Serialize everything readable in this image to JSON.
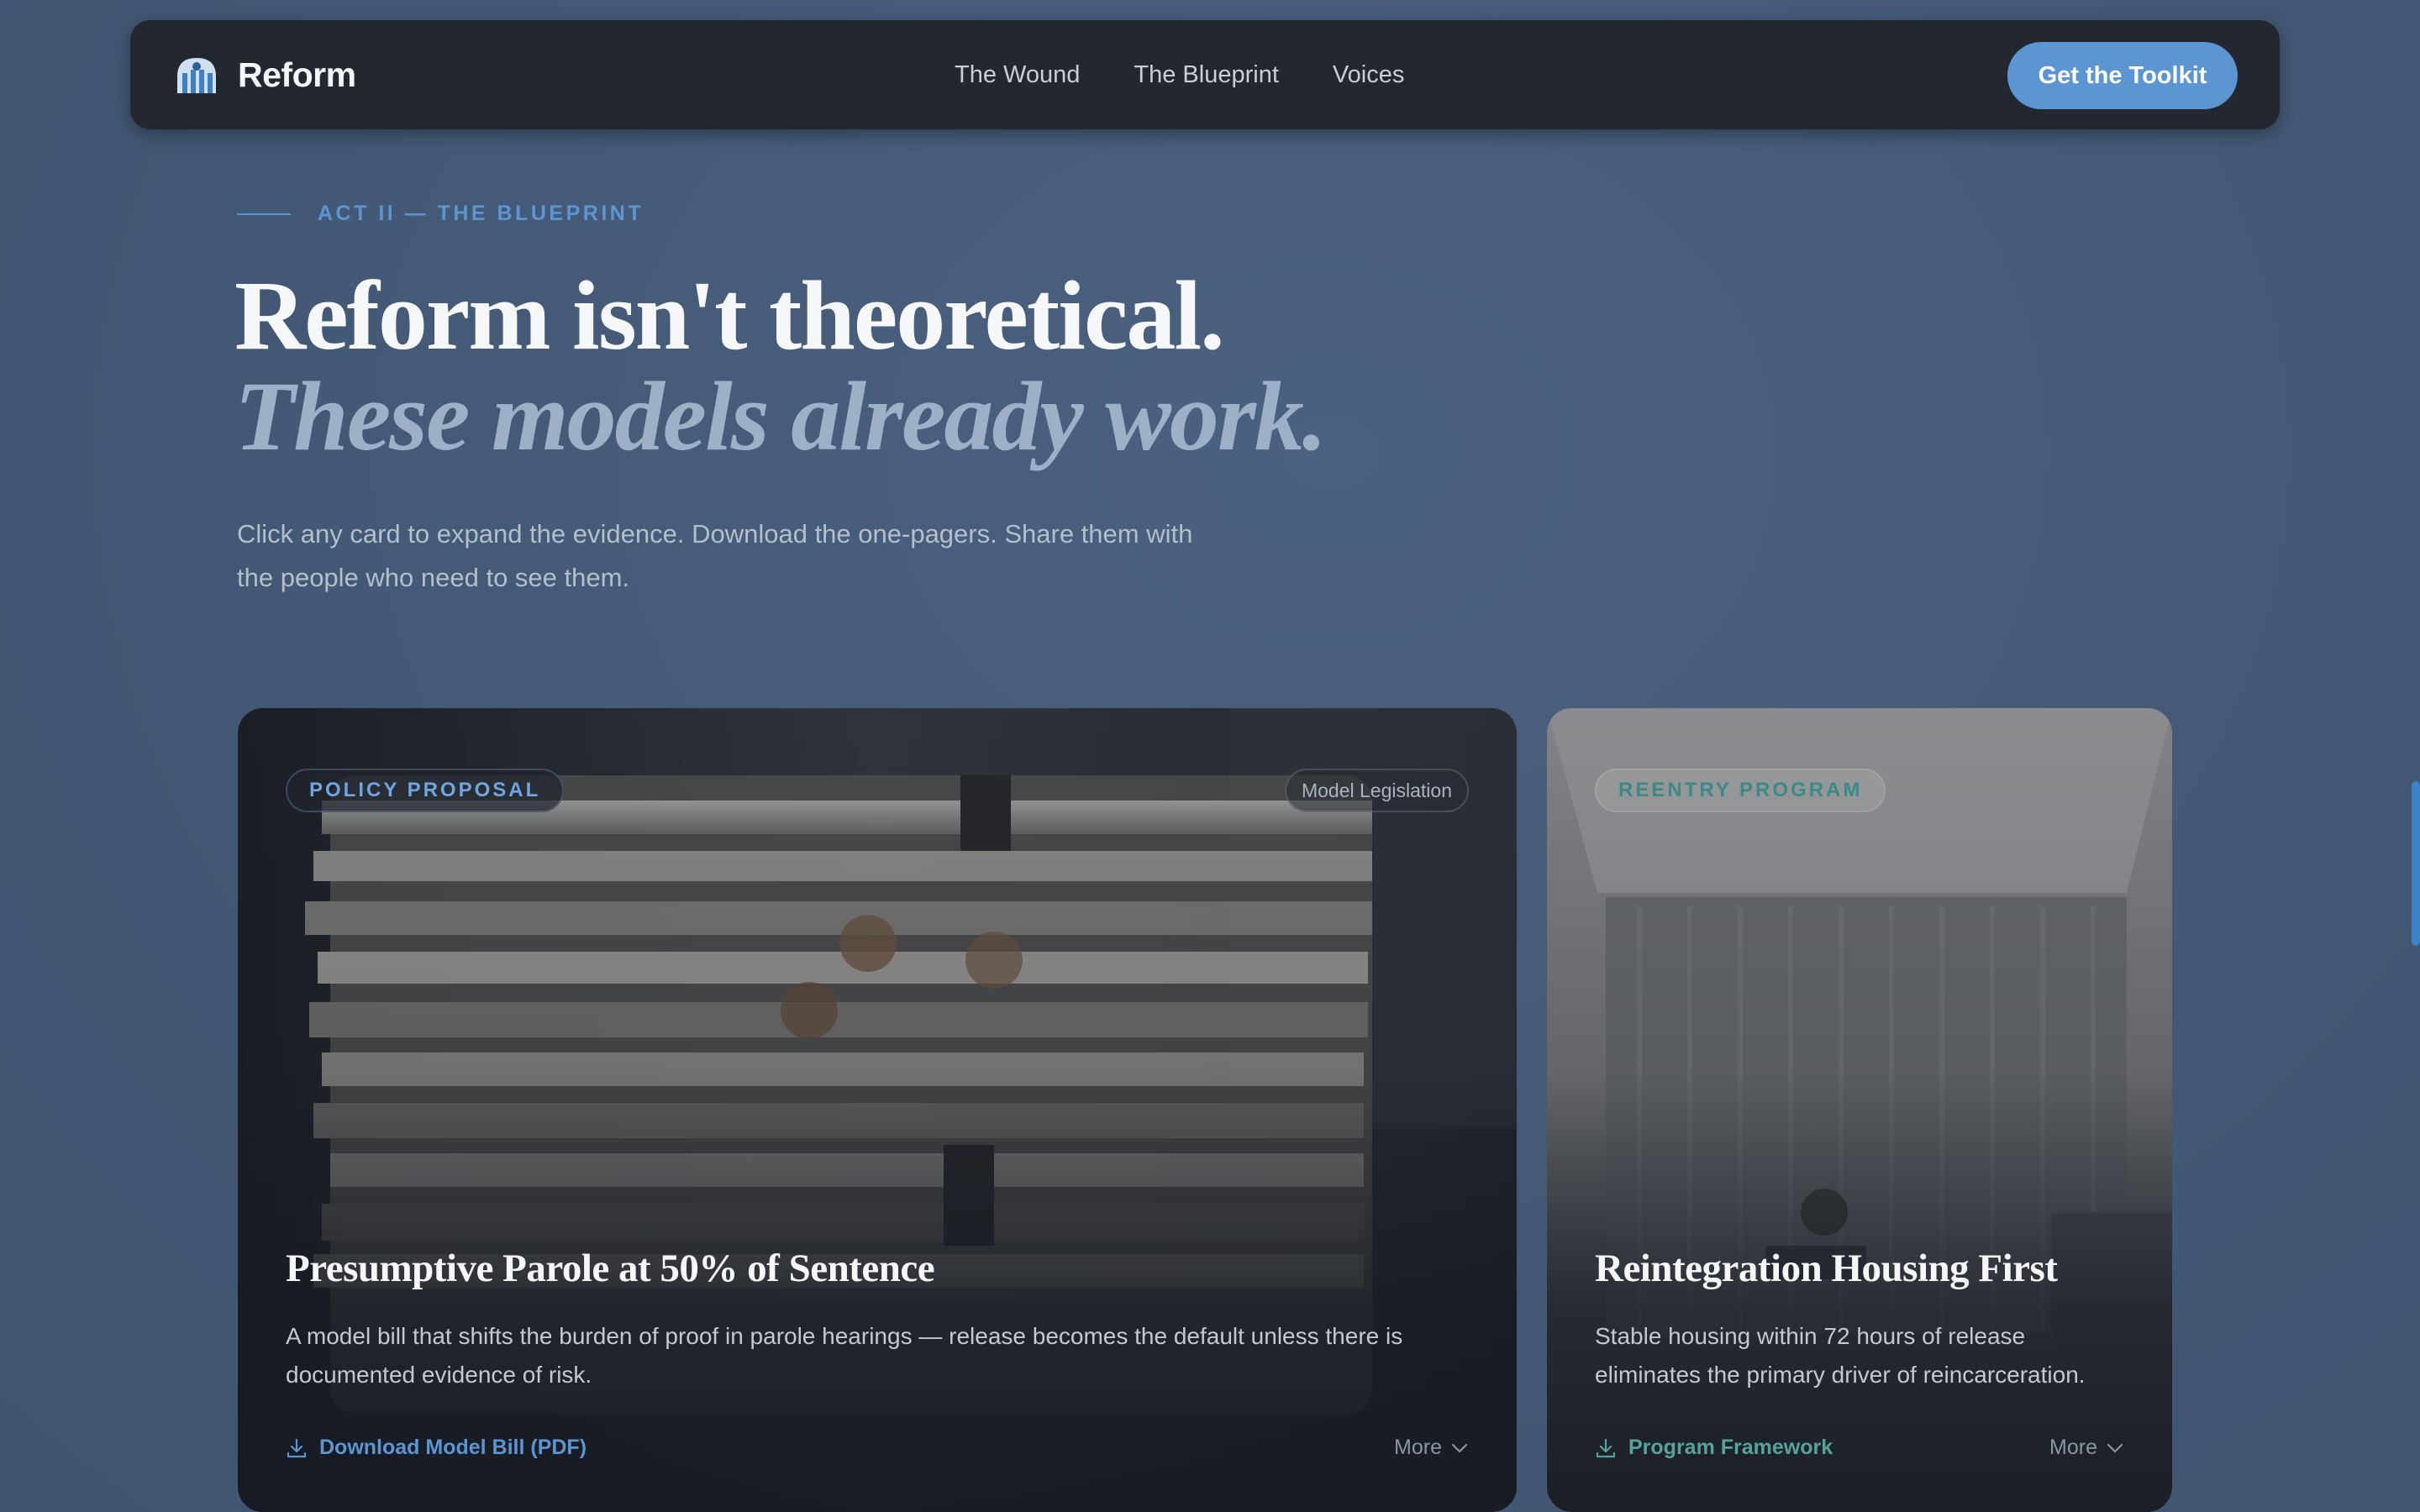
{
  "nav": {
    "brand": "Reform",
    "links": [
      "The Wound",
      "The Blueprint",
      "Voices"
    ],
    "cta": "Get the Toolkit"
  },
  "hero": {
    "eyebrow": "ACT II — THE BLUEPRINT",
    "headline_line1": "Reform isn't theoretical.",
    "headline_line2": "These models already work.",
    "lede": "Click any card to expand the evidence. Download the one-pagers. Share them with the people who need to see them."
  },
  "cards": [
    {
      "tag": "POLICY PROPOSAL",
      "chip": "Model Legislation",
      "title": "Presumptive Parole at 50% of Sentence",
      "description": "A model bill that shifts the burden of proof in parole hearings — release becomes the default unless there is documented evidence of risk.",
      "download": "Download Model Bill (PDF)",
      "more": "More",
      "image": "stacked-legal-documents-photo"
    },
    {
      "tag": "REENTRY PROGRAM",
      "title": "Reintegration Housing First",
      "description": "Stable housing within 72 hours of release eliminates the primary driver of reincarceration.",
      "download": "Program Framework",
      "more": "More",
      "image": "empty-apartment-room-photo"
    }
  ],
  "colors": {
    "accent": "#5b96d3",
    "accent_teal": "#56a39d",
    "nav_bg": "#23272f",
    "page_bg": "#455b77"
  }
}
